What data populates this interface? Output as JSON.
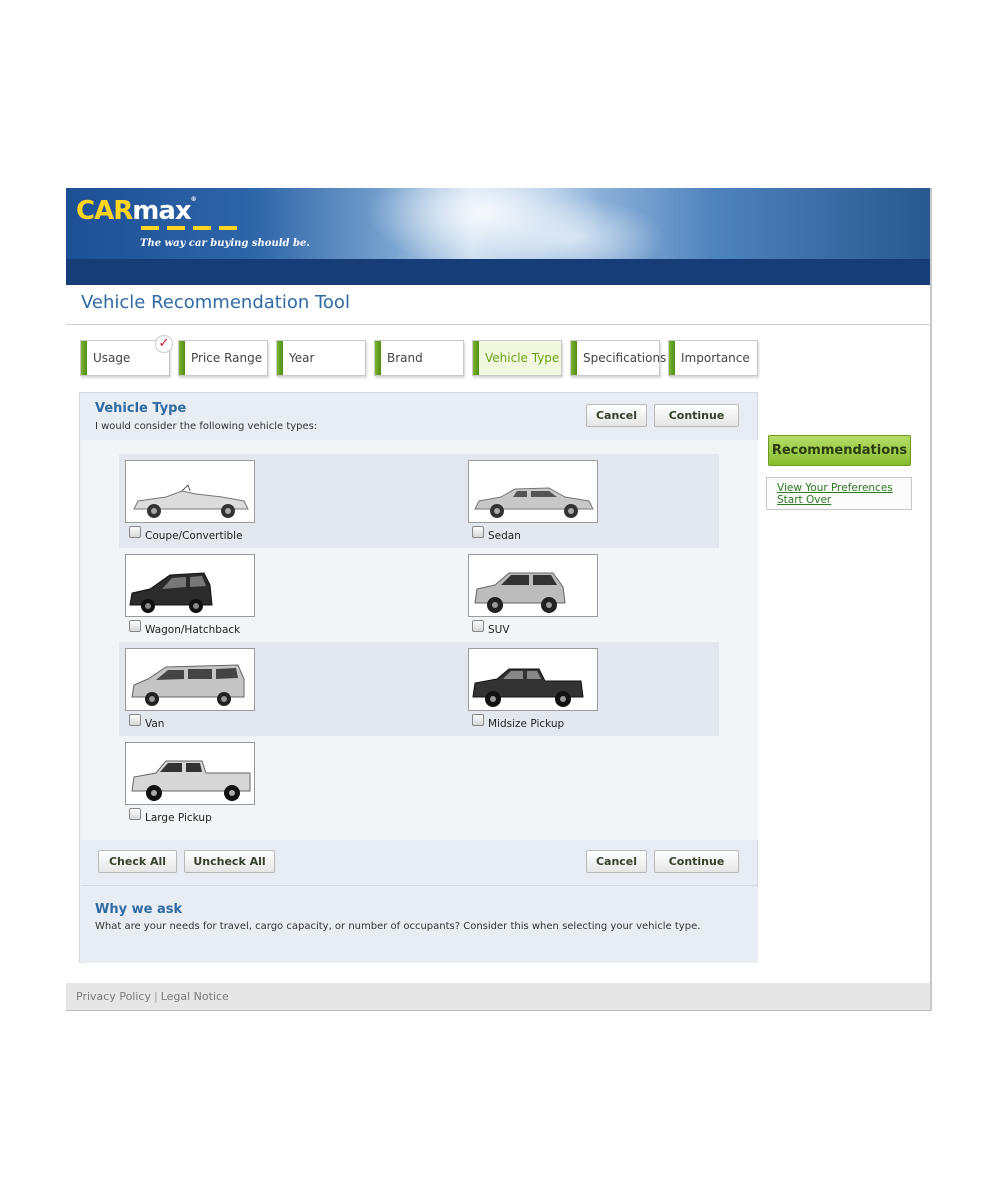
{
  "brand": {
    "logo_car": "CAR",
    "logo_max": "max",
    "tagline": "The way car buying should be."
  },
  "page_title": "Vehicle Recommendation Tool",
  "steps": [
    {
      "label": "Usage",
      "completed": true
    },
    {
      "label": "Price Range"
    },
    {
      "label": "Year"
    },
    {
      "label": "Brand"
    },
    {
      "label": "Vehicle Type",
      "active": true
    },
    {
      "label": "Specifications"
    },
    {
      "label": "Importance"
    }
  ],
  "panel": {
    "title": "Vehicle Type",
    "subtitle": "I would consider the following vehicle types:",
    "cancel_label": "Cancel",
    "continue_label": "Continue",
    "check_all_label": "Check All",
    "uncheck_all_label": "Uncheck All"
  },
  "vehicles": [
    {
      "label": "Coupe/Convertible",
      "checked": false,
      "icon": "convertible-car-image"
    },
    {
      "label": "Sedan",
      "checked": false,
      "icon": "sedan-car-image"
    },
    {
      "label": "Wagon/Hatchback",
      "checked": false,
      "icon": "hatchback-car-image"
    },
    {
      "label": "SUV",
      "checked": false,
      "icon": "suv-car-image"
    },
    {
      "label": "Van",
      "checked": false,
      "icon": "van-car-image"
    },
    {
      "label": "Midsize Pickup",
      "checked": false,
      "icon": "midsize-pickup-image"
    },
    {
      "label": "Large Pickup",
      "checked": false,
      "icon": "large-pickup-image"
    }
  ],
  "why": {
    "title": "Why we ask",
    "text": "What are your needs for travel, cargo capacity, or number of occupants? Consider this when selecting your vehicle type."
  },
  "sidebar": {
    "recommendations_label": "Recommendations",
    "view_preferences_label": "View Your Preferences",
    "start_over_label": "Start Over"
  },
  "footer": {
    "privacy_label": "Privacy Policy",
    "separator": "|",
    "legal_label": "Legal Notice"
  },
  "colors": {
    "accent_blue": "#2f6aa4",
    "step_green": "#69a218",
    "header_navy": "#163d78",
    "logo_yellow": "#ffd520"
  }
}
